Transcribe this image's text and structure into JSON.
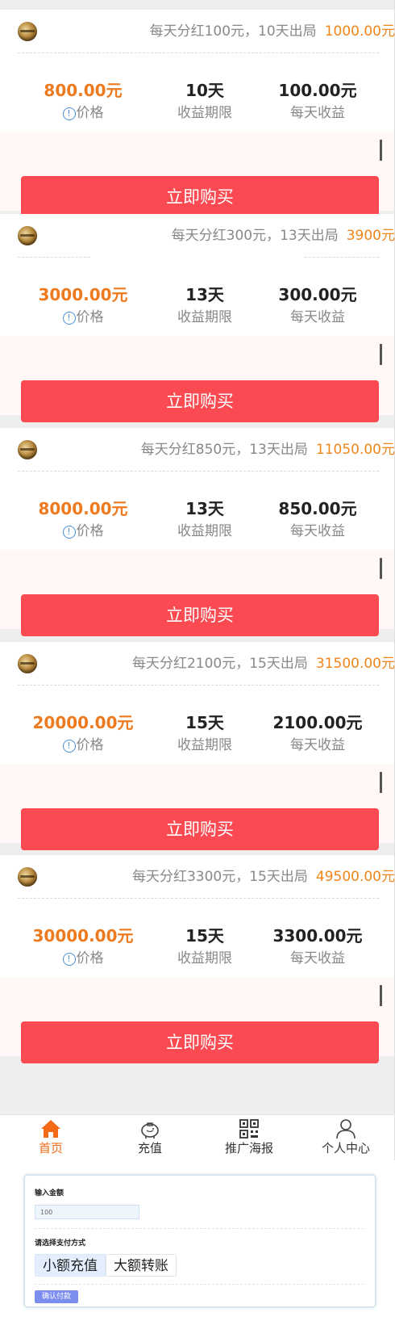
{
  "products": [
    {
      "desc": "每天分红100元，10天出局",
      "total": "1000.00元",
      "price": "800.00元",
      "term": "10天",
      "daily": "100.00元"
    },
    {
      "desc": "每天分红300元，13天出局",
      "total": "3900元",
      "price": "3000.00元",
      "term": "13天",
      "daily": "300.00元"
    },
    {
      "desc": "每天分红850元，13天出局",
      "total": "11050.00元",
      "price": "8000.00元",
      "term": "13天",
      "daily": "850.00元"
    },
    {
      "desc": "每天分红2100元，15天出局",
      "total": "31500.00元",
      "price": "20000.00元",
      "term": "15天",
      "daily": "2100.00元"
    },
    {
      "desc": "每天分红3300元，15天出局",
      "total": "49500.00元",
      "price": "30000.00元",
      "term": "15天",
      "daily": "3300.00元"
    }
  ],
  "labels": {
    "price_label": "价格",
    "term_label": "收益期限",
    "daily_label": "每天收益",
    "buy_button": "立即购买"
  },
  "tabs": [
    {
      "label": "首页",
      "icon": "home-icon"
    },
    {
      "label": "充值",
      "icon": "piggy-bank-icon"
    },
    {
      "label": "推广海报",
      "icon": "qr-code-icon"
    },
    {
      "label": "个人中心",
      "icon": "user-icon"
    }
  ],
  "payment": {
    "amount_title": "输入金额",
    "amount_value": "100",
    "method_title": "请选择支付方式",
    "methods": [
      "小额充值",
      "大额转账"
    ],
    "confirm_label": "确认付款"
  },
  "colors": {
    "accent_orange": "#f08519",
    "buy_button_red": "#fb4a51",
    "active_tab": "#f36b16",
    "confirm_blue": "#7c8df0"
  }
}
